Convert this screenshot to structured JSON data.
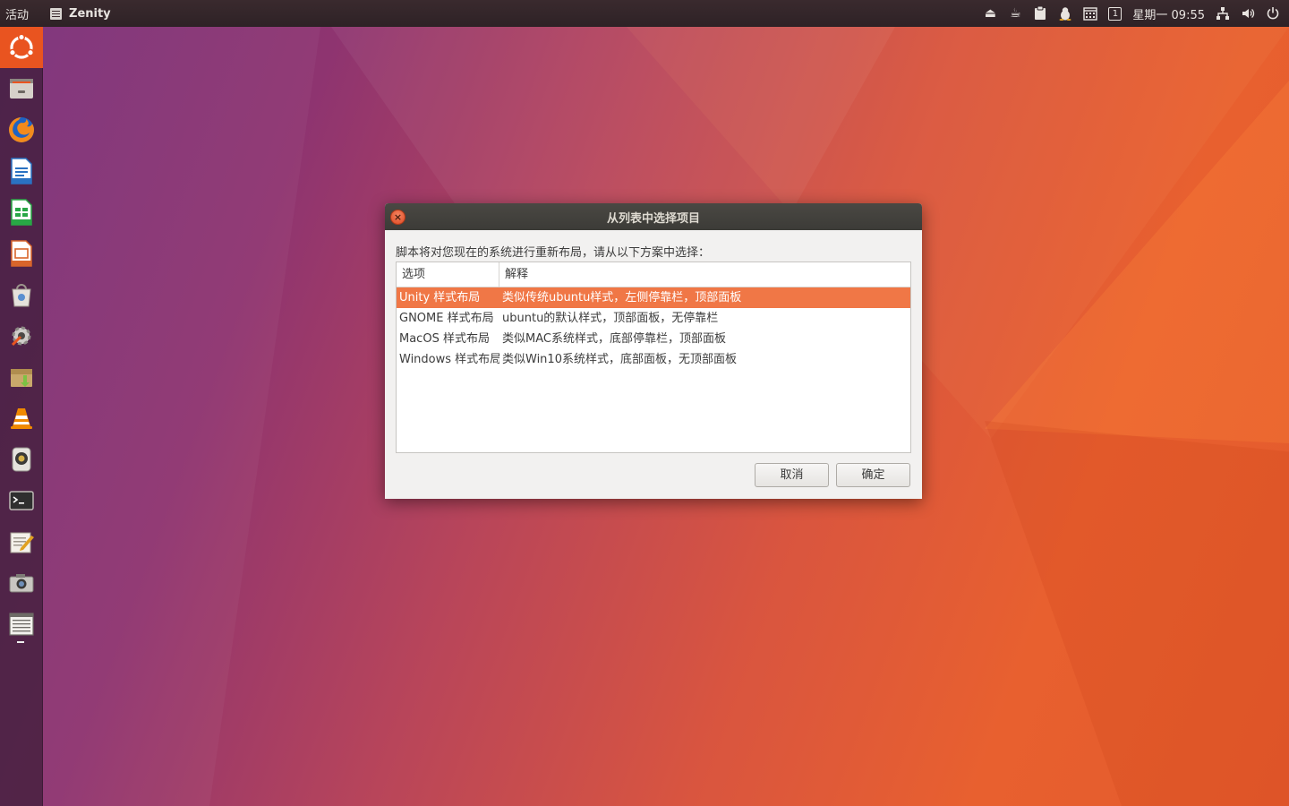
{
  "top_panel": {
    "activities": "活动",
    "app_name": "Zenity",
    "workspace": "1",
    "clock": "星期一 09:55"
  },
  "launcher": {
    "items": [
      {
        "name": "ubuntu-dash-icon",
        "color": "#e95420"
      },
      {
        "name": "file-manager-icon",
        "color": "#c9c4bd"
      },
      {
        "name": "firefox-icon",
        "color": "#e66000"
      },
      {
        "name": "writer-icon",
        "color": "#2a72c2"
      },
      {
        "name": "calc-icon",
        "color": "#28a745"
      },
      {
        "name": "impress-icon",
        "color": "#d9652b"
      },
      {
        "name": "software-center-icon",
        "color": "#dcd7d0"
      },
      {
        "name": "system-settings-icon",
        "color": "#c8c6c2"
      },
      {
        "name": "archive-manager-icon",
        "color": "#b8955c"
      },
      {
        "name": "vlc-icon",
        "color": "#f08a00"
      },
      {
        "name": "rhythmbox-icon",
        "color": "#d8d4cf"
      },
      {
        "name": "terminal-icon",
        "color": "#2f2f2f"
      },
      {
        "name": "text-editor-icon",
        "color": "#e9e4da"
      },
      {
        "name": "screenshot-icon",
        "color": "#bdbab5"
      },
      {
        "name": "zenity-list-icon",
        "color": "#e9e7e3"
      }
    ]
  },
  "dialog": {
    "title": "从列表中选择项目",
    "prompt": "脚本将对您现在的系统进行重新布局，请从以下方案中选择：",
    "columns": [
      "选项",
      "解释"
    ],
    "rows": [
      {
        "option": "Unity 样式布局",
        "desc": "类似传统ubuntu样式，左侧停靠栏，顶部面板",
        "selected": true
      },
      {
        "option": "GNOME 样式布局",
        "desc": "ubuntu的默认样式，顶部面板，无停靠栏",
        "selected": false
      },
      {
        "option": "MacOS 样式布局",
        "desc": "类似MAC系统样式，底部停靠栏，顶部面板",
        "selected": false
      },
      {
        "option": "Windows 样式布局",
        "desc": "类似Win10系统样式，底部面板，无顶部面板",
        "selected": false
      }
    ],
    "cancel_label": "取消",
    "ok_label": "确定"
  },
  "colors": {
    "accent": "#e95420",
    "selection": "#f07746"
  }
}
